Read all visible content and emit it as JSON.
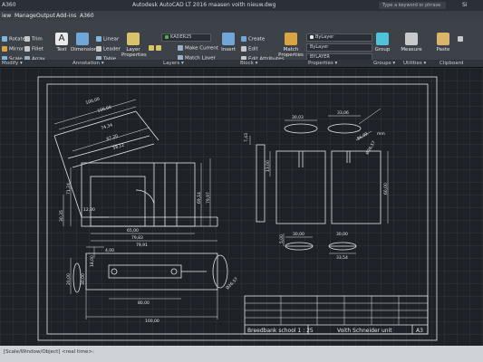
{
  "titlebar": {
    "quick_access": "A360",
    "title": "Autodesk AutoCAD LT 2016   maasen voith nieuw.dwg",
    "search_placeholder": "Type a keyword or phrase",
    "user": "Si"
  },
  "menu_tabs": [
    "iew",
    "Manage",
    "Output",
    "Add-ins",
    "A360"
  ],
  "ribbon": {
    "modify": {
      "rotate": "Rotate",
      "trim": "Trim",
      "mirror": "Mirror",
      "fillet": "Fillet",
      "scale": "Scale",
      "array": "Array"
    },
    "annotation": {
      "text": "Text",
      "dimension": "Dimension",
      "linear": "Linear",
      "leader": "Leader",
      "table": "Table"
    },
    "layers": {
      "layer_properties": "Layer Properties",
      "current_layer": "KADER25",
      "make_current": "Make Current",
      "match_layer": "Match Layer"
    },
    "block": {
      "insert": "Insert",
      "create": "Create",
      "edit": "Edit",
      "edit_attributes": "Edit Attributes"
    },
    "properties": {
      "match_properties": "Match Properties",
      "bylayer1": "ByLayer",
      "bylayer2": "ByLayer",
      "bylayer3": "BYLAYER"
    },
    "groups": {
      "group": "Group"
    },
    "utilities": {
      "measure": "Measure"
    },
    "clipboard": {
      "paste": "Paste"
    }
  },
  "panel_labels": {
    "modify": "Modify ▾",
    "annotation": "Annotation ▾",
    "layers": "Layers ▾",
    "block": "Block ▾",
    "properties": "Properties ▾",
    "groups": "Groups ▾",
    "utilities": "Utilities ▾",
    "clipboard": "Clipboard"
  },
  "drawing": {
    "dims": {
      "d100a": "100,00",
      "d100b": "100,00",
      "d74_34": "74,34",
      "d67": "67,20",
      "d58": "58,12",
      "d71": "71,24",
      "d30_35": "30,35",
      "d12": "12,00",
      "d69_14": "69,14",
      "d79_97": "79,97",
      "d65": "65,00",
      "d79_83": "79,83",
      "d79_91": "79,91",
      "d86_99": "86,99",
      "d30_03": "30,03",
      "d33_06": "33,06",
      "d7_43": "7,43",
      "d13": "13,00",
      "d60": "60,00",
      "d30_00a": "30,00",
      "d33_54": "33,54",
      "d30_00b": "30,00",
      "d5_00": "5,00",
      "d18": "18,00",
      "d4_00": "4,00",
      "d20_00": "20,00",
      "d30_00c": "30,00",
      "d80_00": "80,00",
      "d100_00": "100,00",
      "dR": "Ø26,57",
      "dR2": "Ø26,57",
      "dmm": "mm"
    },
    "titleblock": {
      "main_title": "Breedbank school 1 : 25",
      "author": "Voith Schneider unit",
      "sheet": "A3"
    }
  },
  "command_line": {
    "text": "[Scale/Window/Object] <real time>:"
  }
}
